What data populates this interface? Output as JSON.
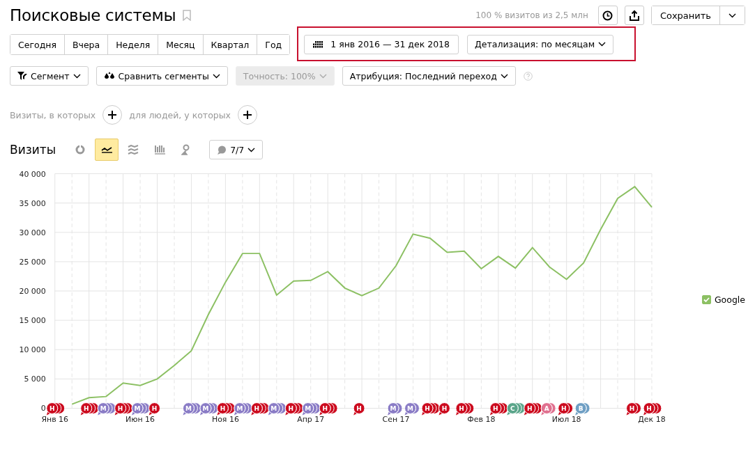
{
  "header": {
    "title": "Поисковые системы",
    "bookmarked": false,
    "sample_info": "100 % визитов из 2,5 млн",
    "save_label": "Сохранить"
  },
  "periods": [
    {
      "label": "Сегодня",
      "selected": false
    },
    {
      "label": "Вчера",
      "selected": false
    },
    {
      "label": "Неделя",
      "selected": false
    },
    {
      "label": "Месяц",
      "selected": false
    },
    {
      "label": "Квартал",
      "selected": false
    },
    {
      "label": "Год",
      "selected": false
    }
  ],
  "date_range": "1 янв 2016 — 31 дек 2018",
  "detail": "Детализация: по месяцам",
  "filters": [
    {
      "label": "Сегмент",
      "kind": "segment",
      "disabled": false
    },
    {
      "label": "Сравнить сегменты",
      "kind": "compare",
      "disabled": false
    },
    {
      "label": "Точность: 100%",
      "kind": "plain",
      "disabled": true
    },
    {
      "label": "Атрибуция: Последний переход",
      "kind": "plain",
      "disabled": false
    }
  ],
  "conditions": [
    "Визиты, в которых",
    "для людей, у которых"
  ],
  "chart_header": {
    "title": "Визиты",
    "views": [
      {
        "kind": "pie",
        "selected": false
      },
      {
        "kind": "line",
        "selected": true
      },
      {
        "kind": "area",
        "selected": false
      },
      {
        "kind": "bars",
        "selected": false
      },
      {
        "kind": "map",
        "selected": false
      }
    ],
    "notes_count": "7/7"
  },
  "chart_data": {
    "type": "line",
    "categories": [
      "Янв 16",
      null,
      null,
      null,
      null,
      "Июн 16",
      null,
      null,
      null,
      null,
      "Ноя 16",
      null,
      null,
      null,
      null,
      "Апр 17",
      null,
      null,
      null,
      null,
      "Сен 17",
      null,
      null,
      null,
      null,
      "Фев 18",
      null,
      null,
      null,
      null,
      "Июл 18",
      null,
      null,
      null,
      null,
      "Дек 18"
    ],
    "ylim": [
      0,
      40000
    ],
    "yticks": [
      {
        "value": 0,
        "label": "0"
      },
      {
        "value": 5000,
        "label": "5 000"
      },
      {
        "value": 10000,
        "label": "10 000"
      },
      {
        "value": 15000,
        "label": "15 000"
      },
      {
        "value": 20000,
        "label": "20 000"
      },
      {
        "value": 25000,
        "label": "25 000"
      },
      {
        "value": 30000,
        "label": "30 000"
      },
      {
        "value": 35000,
        "label": "35 000"
      },
      {
        "value": 40000,
        "label": "40 000"
      }
    ],
    "grid": true,
    "series": [
      {
        "name": "Google",
        "color": "#8cc063",
        "values": [
          null,
          700,
          1800,
          2000,
          4300,
          3900,
          5000,
          7300,
          9800,
          16000,
          21500,
          26400,
          26400,
          19300,
          21700,
          21800,
          23300,
          20500,
          19200,
          20500,
          24300,
          29700,
          29000,
          26600,
          26800,
          23800,
          25900,
          23900,
          27400,
          24100,
          22000,
          24800,
          30500,
          35800,
          37800,
          34300
        ]
      }
    ]
  },
  "legend": [
    {
      "checked": true
    }
  ],
  "note_markers": [
    {
      "label": "Н",
      "color": "#cc0a1e"
    },
    {
      "label": "Н",
      "color": "#cc0a1e"
    },
    {
      "label": "М",
      "color": "#8a7cc6"
    },
    {
      "label": "Н",
      "color": "#cc0a1e"
    },
    {
      "label": "М",
      "color": "#8a7cc6"
    },
    {
      "label": "Н",
      "color": "#cc0a1e"
    },
    {
      "label": "М",
      "color": "#8a7cc6"
    },
    {
      "label": "М",
      "color": "#8a7cc6"
    },
    {
      "label": "Н",
      "color": "#cc0a1e"
    },
    {
      "label": "М",
      "color": "#8a7cc6"
    },
    {
      "label": "Н",
      "color": "#cc0a1e"
    },
    {
      "label": "М",
      "color": "#8a7cc6"
    },
    {
      "label": "Н",
      "color": "#cc0a1e"
    },
    {
      "label": "М",
      "color": "#8a7cc6"
    },
    {
      "label": "Н",
      "color": "#cc0a1e"
    },
    {
      "label": "Н",
      "color": "#cc0a1e"
    },
    {
      "label": "М",
      "color": "#8a7cc6"
    },
    {
      "label": "М",
      "color": "#8a7cc6"
    },
    {
      "label": "Н",
      "color": "#cc0a1e"
    },
    {
      "label": "Н",
      "color": "#cc0a1e"
    },
    {
      "label": "Н",
      "color": "#cc0a1e"
    },
    {
      "label": "Н",
      "color": "#cc0a1e"
    },
    {
      "label": "С",
      "color": "#5aa58a"
    },
    {
      "label": "Н",
      "color": "#cc0a1e"
    },
    {
      "label": "А",
      "color": "#e0708f"
    },
    {
      "label": "Н",
      "color": "#cc0a1e"
    },
    {
      "label": "В",
      "color": "#6f9fc4"
    },
    {
      "label": "Н",
      "color": "#cc0a1e"
    },
    {
      "label": "Н",
      "color": "#cc0a1e"
    }
  ]
}
